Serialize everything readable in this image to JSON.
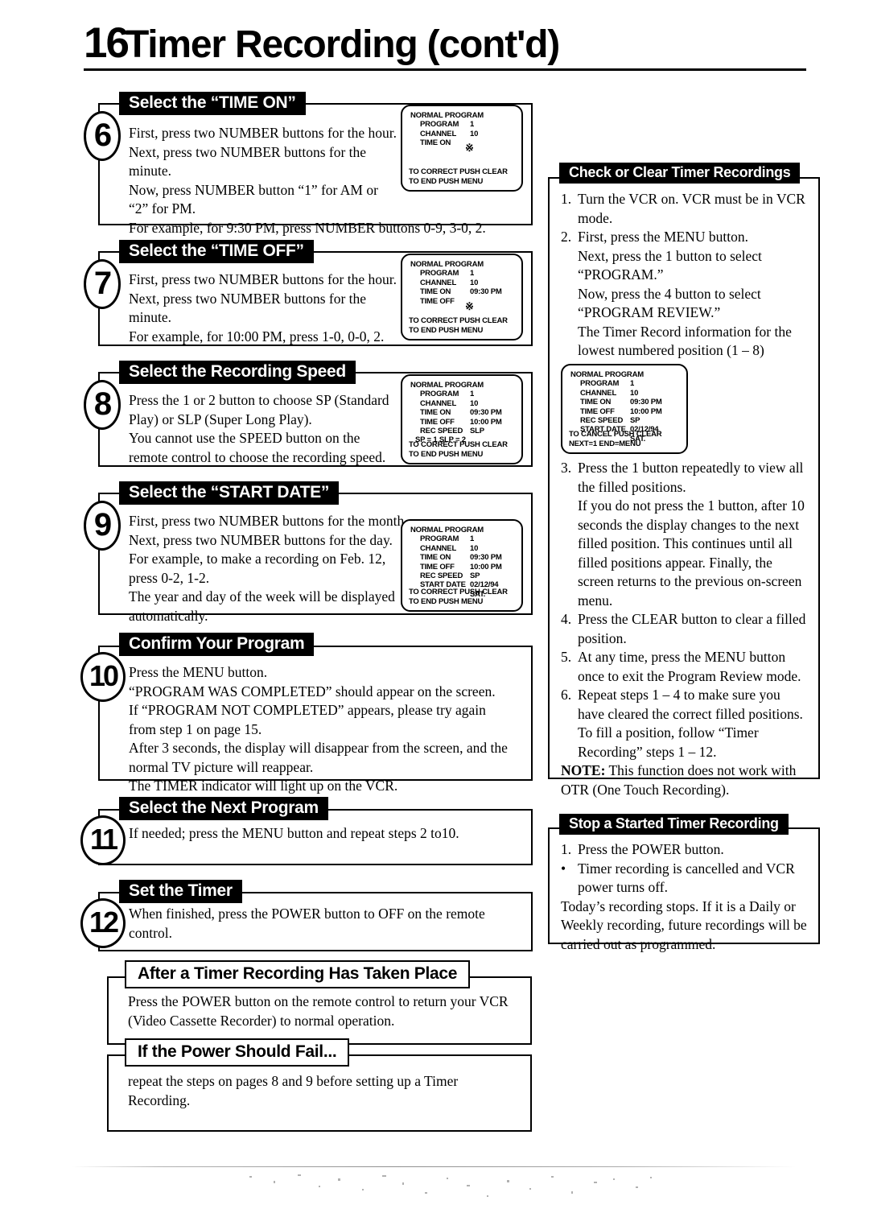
{
  "page": {
    "number": "16",
    "title": "Timer Recording (cont'd)"
  },
  "left_column": {
    "steps": [
      {
        "number": "6",
        "heading": "Select the “TIME ON”",
        "text": "First, press two NUMBER buttons for the hour.\nNext, press two NUMBER buttons for the\nminute.\nNow, press NUMBER button “1” for AM or\n“2” for PM.\nFor example, for 9:30 PM, press NUMBER buttons 0-9, 3-0, 2.",
        "osd": {
          "header": "NORMAL PROGRAM",
          "rows": [
            {
              "label": "PROGRAM",
              "value": "1",
              "blinking": false
            },
            {
              "label": "CHANNEL",
              "value": "10",
              "blinking": false
            },
            {
              "label": "TIME ON",
              "value": "",
              "blinking": true
            }
          ],
          "footer": [
            "TO CORRECT PUSH CLEAR",
            "TO END PUSH MENU"
          ]
        }
      },
      {
        "number": "7",
        "heading": "Select the “TIME OFF”",
        "text": "First, press two NUMBER buttons for the hour.\nNext, press two NUMBER buttons for the\nminute.\nFor example, for 10:00 PM, press 1-0, 0-0, 2.",
        "osd": {
          "header": "NORMAL PROGRAM",
          "rows": [
            {
              "label": "PROGRAM",
              "value": "1",
              "blinking": false
            },
            {
              "label": "CHANNEL",
              "value": "10",
              "blinking": false
            },
            {
              "label": "TIME ON",
              "value": "09:30 PM",
              "blinking": false
            },
            {
              "label": "TIME OFF",
              "value": "",
              "blinking": true
            }
          ],
          "footer": [
            "TO CORRECT PUSH CLEAR",
            "TO END PUSH MENU"
          ]
        }
      },
      {
        "number": "8",
        "heading": "Select the Recording Speed",
        "text": "Press the 1 or 2 button to choose SP (Standard\nPlay) or SLP (Super Long Play).\nYou cannot use the SPEED button on the\nremote control to choose the recording speed.",
        "osd": {
          "header": "NORMAL PROGRAM",
          "rows": [
            {
              "label": "PROGRAM",
              "value": "1",
              "blinking": false
            },
            {
              "label": "CHANNEL",
              "value": "10",
              "blinking": false
            },
            {
              "label": "TIME ON",
              "value": "09:30 PM",
              "blinking": false
            },
            {
              "label": "TIME OFF",
              "value": "10:00 PM",
              "blinking": false
            },
            {
              "label": "REC SPEED",
              "value": "SLP",
              "blinking": true
            }
          ],
          "extra_line": "SP = 1   SLP = 2",
          "footer": [
            "TO CORRECT PUSH CLEAR",
            "TO END PUSH MENU"
          ]
        }
      },
      {
        "number": "9",
        "heading": "Select the “START DATE”",
        "text": "First, press two NUMBER buttons for the month.\nNext, press two NUMBER buttons for the day.\nFor example, to make a recording on Feb. 12,\npress 0-2, 1-2.\nThe year and day of the week will be displayed\nautomatically.",
        "osd": {
          "header": "NORMAL PROGRAM",
          "rows": [
            {
              "label": "PROGRAM",
              "value": "1",
              "blinking": false
            },
            {
              "label": "CHANNEL",
              "value": "10",
              "blinking": false
            },
            {
              "label": "TIME ON",
              "value": "09:30 PM",
              "blinking": false
            },
            {
              "label": "TIME OFF",
              "value": "10:00 PM",
              "blinking": false
            },
            {
              "label": "REC SPEED",
              "value": "SP",
              "blinking": false
            },
            {
              "label": "START DATE",
              "value": "02/12/94",
              "blinking": false
            },
            {
              "label": "",
              "value": "SAT.",
              "blinking": false
            }
          ],
          "footer": [
            "TO CORRECT PUSH CLEAR",
            "TO END PUSH MENU"
          ]
        }
      },
      {
        "number": "10",
        "heading": "Confirm Your Program",
        "text": "Press the MENU button.\n“PROGRAM WAS COMPLETED” should appear on the screen.\nIf “PROGRAM NOT COMPLETED” appears, please try again\nfrom step 1 on page 15.\nAfter 3 seconds, the display will disappear from the screen, and the\nnormal TV picture will reappear.\nThe TIMER indicator will light up on the VCR."
      },
      {
        "number": "11",
        "heading": "Select the Next Program",
        "text": "If needed; press the MENU button and repeat steps 2 to10."
      },
      {
        "number": "12",
        "heading": "Set the Timer",
        "text": "When finished, press the POWER button to OFF on the remote\ncontrol."
      }
    ],
    "sections": [
      {
        "heading": "After a Timer Recording Has Taken Place",
        "text": "Press the POWER button on the remote control to return your VCR\n(Video Cassette Recorder) to normal operation."
      },
      {
        "heading": "If the Power Should Fail...",
        "text": "repeat the steps on pages 8 and 9 before setting up a Timer\nRecording."
      }
    ]
  },
  "right_column": {
    "check_clear": {
      "heading": "Check or Clear Timer Recordings",
      "items_top": [
        {
          "marker": "1.",
          "text": "Turn the VCR on. VCR must be in VCR\nmode."
        },
        {
          "marker": "2.",
          "text": "First, press the MENU button.\nNext, press the 1 button to select\n“PROGRAM.”\nNow, press the 4 button to select\n“PROGRAM REVIEW.”\nThe Timer Record information for the\nlowest numbered position (1 – 8)\nappears."
        }
      ],
      "osd": {
        "header": "NORMAL PROGRAM",
        "rows": [
          {
            "label": "PROGRAM",
            "value": "1",
            "blinking": false
          },
          {
            "label": "CHANNEL",
            "value": "10",
            "blinking": false
          },
          {
            "label": "TIME ON",
            "value": "09:30 PM",
            "blinking": false
          },
          {
            "label": "TIME OFF",
            "value": "10:00 PM",
            "blinking": false
          },
          {
            "label": "REC SPEED",
            "value": "SP",
            "blinking": false
          },
          {
            "label": "START DATE",
            "value": "02/12/94",
            "blinking": false
          },
          {
            "label": "",
            "value": "SAT.",
            "blinking": false
          }
        ],
        "footer": [
          "TO CANCEL PUSH CLEAR",
          "NEXT=1            END=MENU"
        ]
      },
      "items_bottom": [
        {
          "marker": "3.",
          "text": "Press the 1 button repeatedly to view all\nthe filled positions.\nIf you do not press the 1 button, after 10\nseconds the display changes to the next\nfilled position. This continues until all\nfilled positions appear. Finally, the\nscreen returns to the previous on-screen\nmenu."
        },
        {
          "marker": "4.",
          "text": "Press the CLEAR button to clear a filled\nposition."
        },
        {
          "marker": "5.",
          "text": "At any time, press the MENU button\nonce to exit the Program Review mode."
        },
        {
          "marker": "6.",
          "text": "Repeat steps 1 – 4 to make sure you\nhave cleared the correct filled positions.\nTo fill a position, follow “Timer\nRecording” steps 1 – 12."
        }
      ],
      "note_label": "NOTE:",
      "note_text": " This function does not work with\nOTR (One Touch Recording)."
    },
    "stop_started": {
      "heading": "Stop a Started Timer Recording",
      "items": [
        {
          "marker": "1.",
          "text": "Press the POWER button."
        },
        {
          "marker": "•",
          "text": "Timer recording is cancelled and VCR\npower turns off."
        }
      ],
      "trailing_text": "Today’s recording stops. If it is a Daily or\nWeekly recording, future recordings will be\ncarried out as programmed."
    }
  }
}
